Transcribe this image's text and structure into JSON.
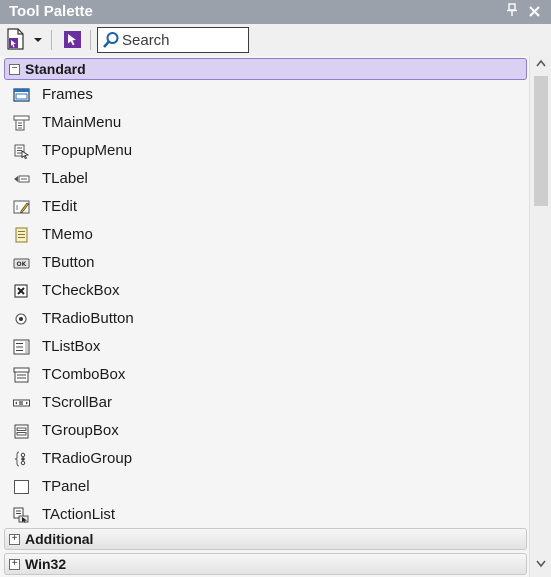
{
  "window": {
    "title": "Tool Palette",
    "pin_icon": "pin-icon",
    "close_icon": "close-icon"
  },
  "toolbar": {
    "search_placeholder": "Search",
    "search_value": ""
  },
  "categories": {
    "standard": {
      "label": "Standard",
      "expanded": true
    },
    "additional": {
      "label": "Additional",
      "expanded": false
    },
    "win32": {
      "label": "Win32",
      "expanded": false
    }
  },
  "components": [
    {
      "label": "Frames",
      "icon": "frames-icon"
    },
    {
      "label": "TMainMenu",
      "icon": "mainmenu-icon"
    },
    {
      "label": "TPopupMenu",
      "icon": "popupmenu-icon"
    },
    {
      "label": "TLabel",
      "icon": "label-icon"
    },
    {
      "label": "TEdit",
      "icon": "edit-icon"
    },
    {
      "label": "TMemo",
      "icon": "memo-icon"
    },
    {
      "label": "TButton",
      "icon": "button-icon"
    },
    {
      "label": "TCheckBox",
      "icon": "checkbox-icon"
    },
    {
      "label": "TRadioButton",
      "icon": "radiobutton-icon"
    },
    {
      "label": "TListBox",
      "icon": "listbox-icon"
    },
    {
      "label": "TComboBox",
      "icon": "combobox-icon"
    },
    {
      "label": "TScrollBar",
      "icon": "scrollbar-icon"
    },
    {
      "label": "TGroupBox",
      "icon": "groupbox-icon"
    },
    {
      "label": "TRadioGroup",
      "icon": "radiogroup-icon"
    },
    {
      "label": "TPanel",
      "icon": "panel-icon"
    },
    {
      "label": "TActionList",
      "icon": "actionlist-icon"
    }
  ],
  "colors": {
    "titlebar": "#9aa1ab",
    "selected_category": "#d9d0f2",
    "selected_category_border": "#8e7fd0"
  }
}
